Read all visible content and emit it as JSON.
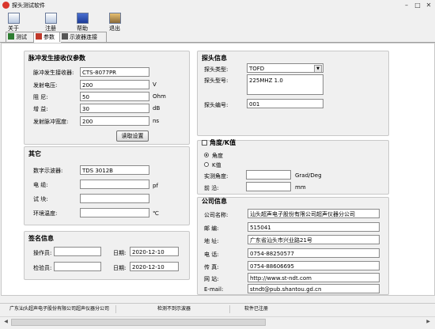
{
  "window": {
    "title": "探头测试软件"
  },
  "toolbar": {
    "items": [
      {
        "label": "关于",
        "icon": "about-icon"
      },
      {
        "label": "注册",
        "icon": "register-icon"
      },
      {
        "label": "帮助",
        "icon": "help-icon"
      },
      {
        "label": "退出",
        "icon": "exit-icon"
      }
    ]
  },
  "tabs": [
    {
      "label": "测试",
      "icon": "test-icon"
    },
    {
      "label": "参数",
      "icon": "params-icon"
    },
    {
      "label": "示波器连接",
      "icon": "oscilloscope-icon"
    }
  ],
  "pulser": {
    "title": "脉冲发生接收仪参数",
    "receiver_label": "脉冲发生接收器:",
    "receiver_value": "CTS-8077PR",
    "voltage_label": "发射电压:",
    "voltage_value": "200",
    "voltage_unit": "V",
    "damping_label": "阻    尼:",
    "damping_value": "50",
    "damping_unit": "Ohm",
    "gain_label": "增    益:",
    "gain_value": "30",
    "gain_unit": "dB",
    "width_label": "发射脉冲宽度:",
    "width_value": "200",
    "width_unit": "ns",
    "read_button": "读取设置"
  },
  "other": {
    "title": "其它",
    "scope_label": "数字示波器:",
    "scope_value": "TDS 3012B",
    "cable_label": "电    缆:",
    "cable_value": "",
    "cable_unit": "pf",
    "block_label": "试    块:",
    "block_value": "",
    "temp_label": "环境温度:",
    "temp_value": "",
    "temp_unit": "℃"
  },
  "sign": {
    "title": "签名信息",
    "operator_label": "操作员:",
    "operator_value": "",
    "op_date_label": "日期:",
    "op_date_value": "2020-12-10",
    "checker_label": "检验员:",
    "checker_value": "",
    "ck_date_label": "日期:",
    "ck_date_value": "2020-12-10"
  },
  "probe": {
    "title": "探头信息",
    "type_label": "探头类型:",
    "type_value": "TOFD",
    "model_label": "探头型号:",
    "model_value": "225MHZ 1.0",
    "serial_label": "探头编号:",
    "serial_value": "001"
  },
  "angle": {
    "title": "角度/K值",
    "opt_angle": "角度",
    "opt_k": "K值",
    "measured_label": "实测角度:",
    "measured_value": "",
    "measured_unit": "Grad/Deg",
    "front_label": "前    沿:",
    "front_value": "",
    "front_unit": "mm"
  },
  "company": {
    "title": "公司信息",
    "name_label": "公司名称:",
    "name_value": "汕头超声电子股份有限公司超声仪器分公司",
    "zip_label": "邮    编:",
    "zip_value": "515041",
    "addr_label": "地    址:",
    "addr_value": "广东省汕头市兴业路21号",
    "tel_label": "电    话:",
    "tel_value": "0754-88250577",
    "fax_label": "传    真:",
    "fax_value": "0754-88606695",
    "web_label": "网    站:",
    "web_value": "http://www.st-ndt.com",
    "email_label": "E-mail:",
    "email_value": "stndt@pub.shantou.gd.cn"
  },
  "status": {
    "company": "广东汕头超声电子股份有限公司超声仪器分公司",
    "scope": "检测不到示波器",
    "license": "软件已注册"
  },
  "colors": {
    "accent": "#d9352b",
    "window_bg": "#f0f0f0",
    "panel_bg": "#ffffff",
    "border": "#c8c8c8"
  }
}
